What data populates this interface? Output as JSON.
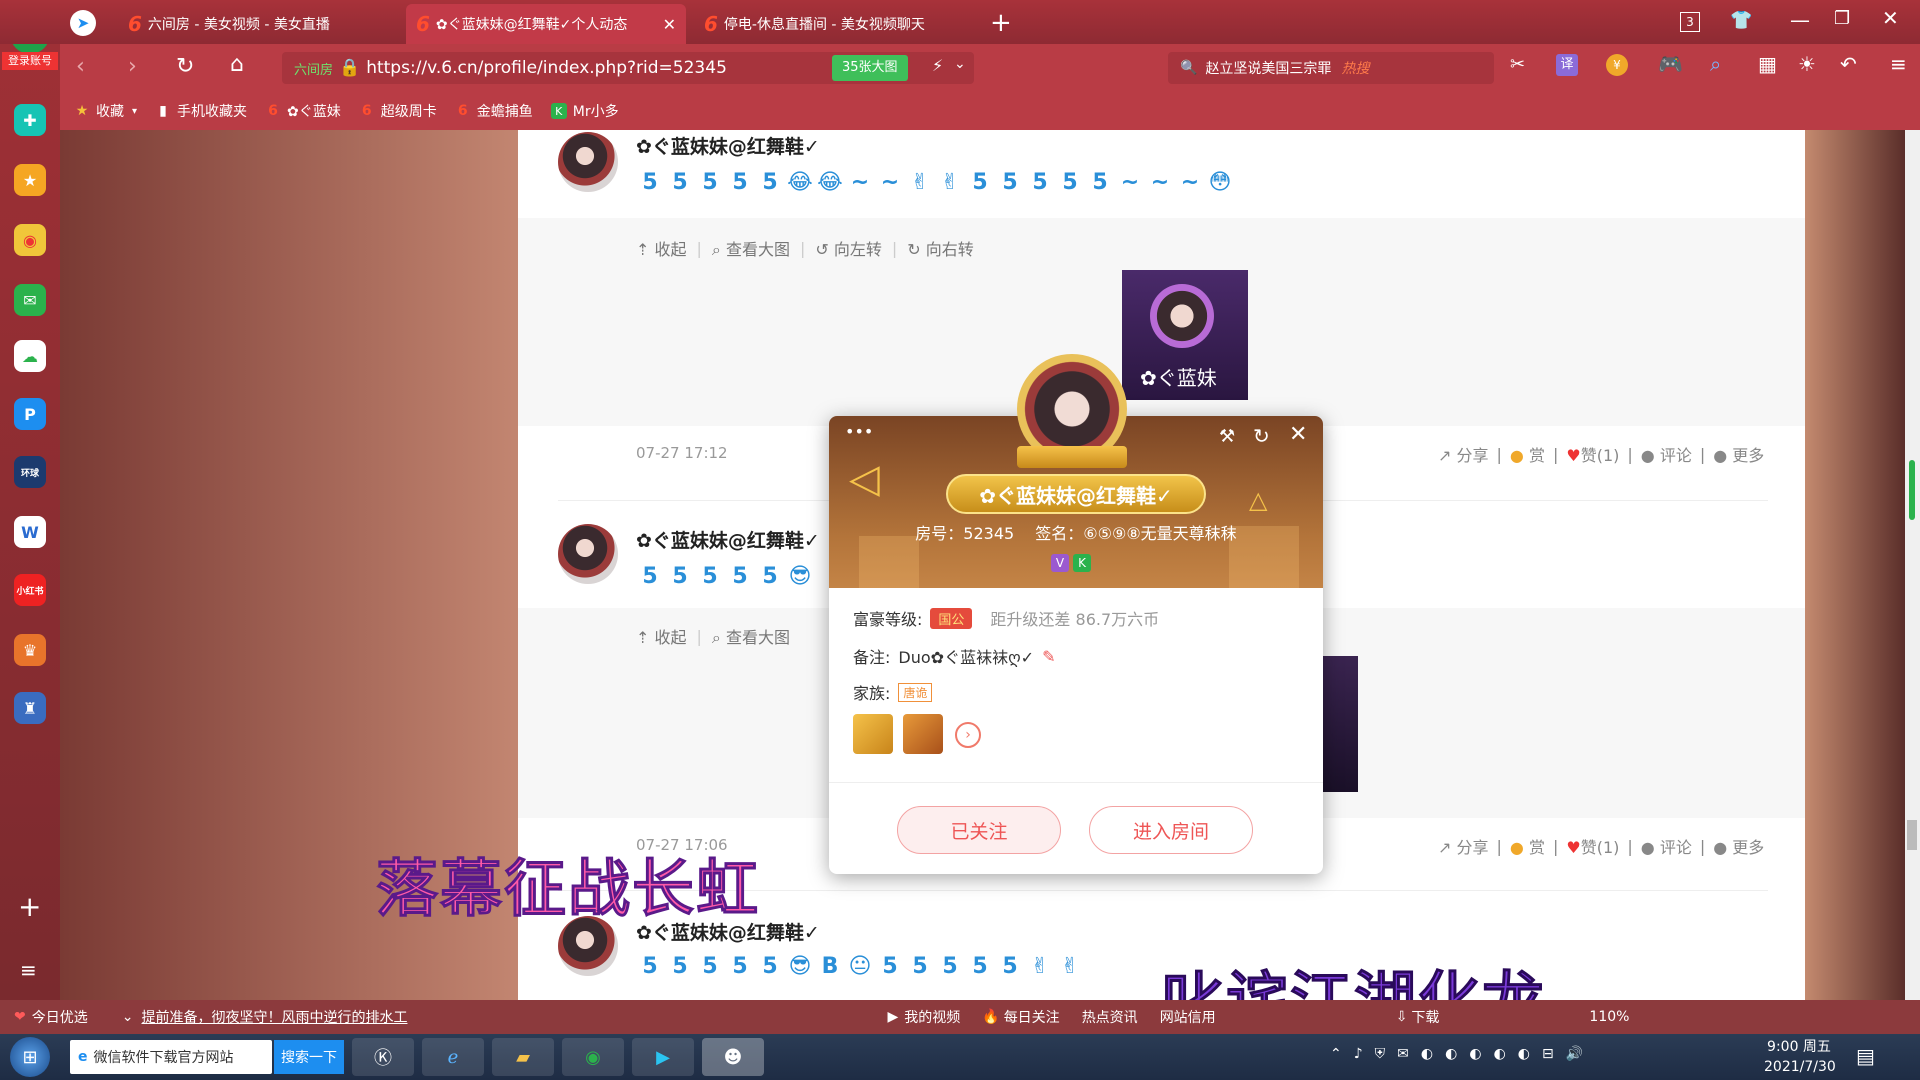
{
  "browser": {
    "login_label": "登录账号",
    "tabs": [
      {
        "label": "六间房 - 美女视频 - 美女直播",
        "active": false
      },
      {
        "label": "✿ぐ蓝妹妹@红舞鞋✓个人动态",
        "active": true
      },
      {
        "label": "停电-休息直播间 - 美女视频聊天",
        "active": false
      }
    ],
    "new_tab": "+",
    "tab_count": "3",
    "url_badge": "六间房",
    "url": "https://v.6.cn/profile/index.php?rid=52345",
    "image_btn": "35张大图",
    "search_text": "赵立坚说美国三宗罪",
    "search_hot": "热搜",
    "translate_label": "译",
    "zoom": "110%"
  },
  "favorites": [
    {
      "label": "收藏",
      "icon": "star-icon"
    },
    {
      "label": "手机收藏夹",
      "icon": "phone-icon"
    },
    {
      "label": "✿ぐ蓝妹",
      "icon": "six-icon"
    },
    {
      "label": "超级周卡",
      "icon": "six-icon"
    },
    {
      "label": "金蟾捕鱼",
      "icon": "six-icon"
    },
    {
      "label": "Mr小多",
      "icon": "k-icon"
    }
  ],
  "posts": [
    {
      "name": "✿ぐ蓝妹妹@红舞鞋✓",
      "line_chars": [
        "5",
        "5",
        "5",
        "5",
        "5",
        "😂",
        "😂",
        "~",
        "~",
        "✌",
        "✌",
        "5",
        "5",
        "5",
        "5",
        "5",
        "~",
        "~",
        "~",
        "😳"
      ],
      "tools": [
        "收起",
        "查看大图",
        "向左转",
        "向右转"
      ],
      "image_caption": "✿ぐ蓝妹",
      "time": "07-27 17:12",
      "actions": [
        "分享",
        "赏",
        "赞(1)",
        "评论",
        "更多"
      ]
    },
    {
      "name": "✿ぐ蓝妹妹@红舞鞋✓",
      "line_chars": [
        "5",
        "5",
        "5",
        "5",
        "5",
        "😎"
      ],
      "tools": [
        "收起",
        "查看大图"
      ],
      "time": "07-27 17:06",
      "actions": [
        "分享",
        "赏",
        "赞(1)",
        "评论",
        "更多"
      ]
    },
    {
      "name": "✿ぐ蓝妹妹@红舞鞋✓",
      "line_chars": [
        "5",
        "5",
        "5",
        "5",
        "5",
        "😎",
        "B",
        "😐",
        "5",
        "5",
        "5",
        "5",
        "5",
        "✌",
        "✌"
      ]
    }
  ],
  "popup": {
    "name": "✿ぐ蓝妹妹@红舞鞋✓",
    "room_label": "房号：52345",
    "sign_label": "签名：⑥⑤⑨⑧无量天尊秣秣",
    "badges": [
      "V",
      "K"
    ],
    "wealth_label": "富豪等级:",
    "wealth_badge": "国公",
    "wealth_next": "距升级还差 86.7万六币",
    "note_label": "备注:",
    "note_value": "Duo✿ぐ蓝袜袜ღ✓",
    "family_label": "家族:",
    "family_badge": "唐诡",
    "followed_btn": "已关注",
    "enter_btn": "进入房间"
  },
  "overlays": {
    "text1": "落幕征战长虹",
    "text2": "叱诧江湖化龙"
  },
  "statusbar": {
    "today": "今日优选",
    "headline": "提前准备，彻夜坚守！风雨中逆行的排水工",
    "items": [
      "我的视频",
      "每日关注",
      "热点资讯",
      "网站信用",
      "下载"
    ],
    "zoom": "110%"
  },
  "taskbar": {
    "search_field": "微信软件下载官方网站",
    "search_btn": "搜索一下",
    "time": "9:00 周五",
    "date": "2021/7/30"
  }
}
